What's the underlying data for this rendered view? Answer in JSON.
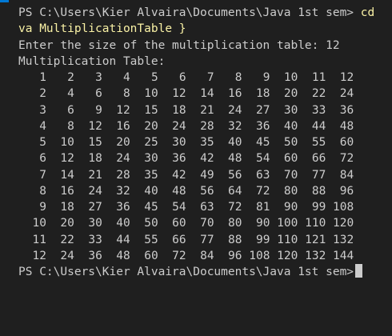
{
  "terminal": {
    "prompt_1": "PS C:\\Users\\Kier Alvaira\\Documents\\Java 1st sem> ",
    "command_part1": "cd",
    "command_part2": "va MultiplicationTable }",
    "input_prompt": "Enter the size of the multiplication table: 12",
    "table_title": "Multiplication Table:",
    "rows": [
      [
        "1",
        "2",
        "3",
        "4",
        "5",
        "6",
        "7",
        "8",
        "9",
        "10",
        "11",
        "12"
      ],
      [
        "2",
        "4",
        "6",
        "8",
        "10",
        "12",
        "14",
        "16",
        "18",
        "20",
        "22",
        "24"
      ],
      [
        "3",
        "6",
        "9",
        "12",
        "15",
        "18",
        "21",
        "24",
        "27",
        "30",
        "33",
        "36"
      ],
      [
        "4",
        "8",
        "12",
        "16",
        "20",
        "24",
        "28",
        "32",
        "36",
        "40",
        "44",
        "48"
      ],
      [
        "5",
        "10",
        "15",
        "20",
        "25",
        "30",
        "35",
        "40",
        "45",
        "50",
        "55",
        "60"
      ],
      [
        "6",
        "12",
        "18",
        "24",
        "30",
        "36",
        "42",
        "48",
        "54",
        "60",
        "66",
        "72"
      ],
      [
        "7",
        "14",
        "21",
        "28",
        "35",
        "42",
        "49",
        "56",
        "63",
        "70",
        "77",
        "84"
      ],
      [
        "8",
        "16",
        "24",
        "32",
        "40",
        "48",
        "56",
        "64",
        "72",
        "80",
        "88",
        "96"
      ],
      [
        "9",
        "18",
        "27",
        "36",
        "45",
        "54",
        "63",
        "72",
        "81",
        "90",
        "99",
        "108"
      ],
      [
        "10",
        "20",
        "30",
        "40",
        "50",
        "60",
        "70",
        "80",
        "90",
        "100",
        "110",
        "120"
      ],
      [
        "11",
        "22",
        "33",
        "44",
        "55",
        "66",
        "77",
        "88",
        "99",
        "110",
        "121",
        "132"
      ],
      [
        "12",
        "24",
        "36",
        "48",
        "60",
        "72",
        "84",
        "96",
        "108",
        "120",
        "132",
        "144"
      ]
    ],
    "prompt_2": "PS C:\\Users\\Kier Alvaira\\Documents\\Java 1st sem>"
  }
}
